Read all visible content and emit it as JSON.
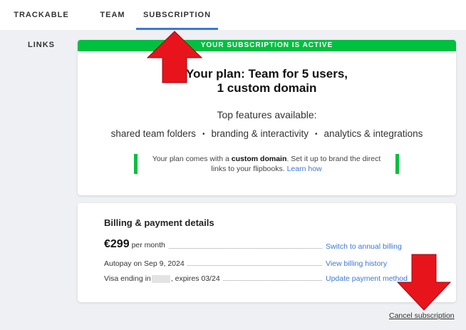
{
  "tabs": [
    {
      "label": "TRACKABLE LINKS"
    },
    {
      "label": "TEAM"
    },
    {
      "label": "SUBSCRIPTION",
      "active": true
    }
  ],
  "plan": {
    "banner": "YOUR SUBSCRIPTION IS ACTIVE",
    "title_line1": "Your plan: Team for 5 users,",
    "title_line2": "1 custom domain",
    "features_title": "Top features available:",
    "features": [
      "shared team folders",
      "branding & interactivity",
      "analytics & integrations"
    ],
    "feature_separator": "•",
    "note_prefix": "Your plan comes with a ",
    "note_bold": "custom domain",
    "note_suffix": ". Set it up to brand the direct links to your flipbooks. ",
    "note_link": "Learn how"
  },
  "billing": {
    "title": "Billing & payment details",
    "price": "€299",
    "price_period": "per month",
    "price_action": "Switch to annual billing",
    "autopay": "Autopay on Sep 9, 2024",
    "autopay_action": "View billing history",
    "card_prefix": "Visa ending in",
    "card_suffix": ", expires 03/24",
    "card_action": "Update payment method"
  },
  "cancel_label": "Cancel subscription",
  "colors": {
    "accent": "#3b78d8",
    "active_green": "#00c040",
    "annotation_red": "#e8141c"
  }
}
